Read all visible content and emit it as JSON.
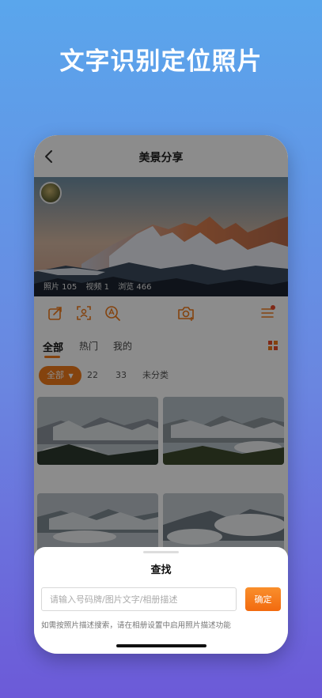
{
  "promo": {
    "title": "文字识别定位照片"
  },
  "nav": {
    "title": "美景分享",
    "back_icon": "chevron-left-icon"
  },
  "banner": {
    "stats": {
      "photos": "照片 105",
      "videos": "视频 1",
      "views": "浏览 466"
    }
  },
  "toolbar": {
    "icons": [
      "share-icon",
      "scan-icon",
      "text-search-icon",
      "camera-add-icon",
      "list-menu-icon"
    ],
    "accent": "#f07a1a"
  },
  "tabs": [
    {
      "label": "全部",
      "active": true
    },
    {
      "label": "热门",
      "active": false
    },
    {
      "label": "我的",
      "active": false
    }
  ],
  "filters": {
    "active": "全部",
    "others": [
      "22",
      "33",
      "未分类"
    ]
  },
  "sheet": {
    "title": "查找",
    "input_placeholder": "请输入号码牌/图片文字/相册描述",
    "confirm_label": "确定",
    "hint": "如需按照片描述搜索，请在相册设置中启用照片描述功能"
  },
  "colors": {
    "accent": "#f07a1a",
    "background_top": "#5aa6ec",
    "background_bottom": "#6c5ad8"
  }
}
